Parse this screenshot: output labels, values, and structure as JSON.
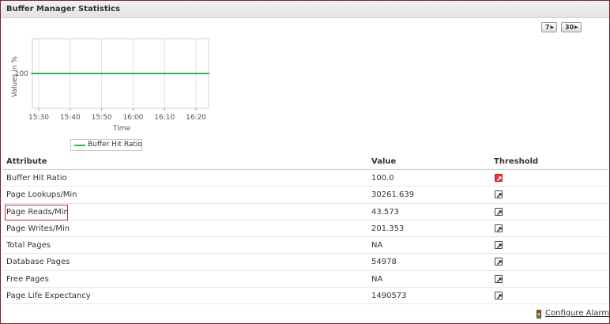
{
  "panel": {
    "title": "Buffer Manager Statistics"
  },
  "period_buttons": [
    {
      "label": "7"
    },
    {
      "label": "30"
    }
  ],
  "chart_data": {
    "type": "line",
    "ylabel": "Values in %",
    "xlabel": "Time",
    "x_ticks": [
      "15:30",
      "15:40",
      "15:50",
      "16:00",
      "16:10",
      "16:20"
    ],
    "y_ticks": [
      100
    ],
    "xlim": [
      "15:28",
      "16:24"
    ],
    "ylim": [
      0,
      200
    ],
    "grid": true,
    "legend_position": "bottom",
    "series": [
      {
        "name": "Buffer Hit Ratio",
        "color": "#3cb043",
        "x": [
          "15:28",
          "15:32",
          "15:36",
          "15:40",
          "15:44",
          "15:48",
          "15:52",
          "15:56",
          "16:00",
          "16:04",
          "16:08",
          "16:12",
          "16:16",
          "16:20",
          "16:24"
        ],
        "values": [
          100,
          100,
          100,
          100,
          100,
          100,
          100,
          100,
          100,
          100,
          100,
          100,
          100,
          100,
          100
        ]
      }
    ]
  },
  "table": {
    "headers": {
      "attribute": "Attribute",
      "value": "Value",
      "threshold": "Threshold"
    },
    "rows": [
      {
        "attribute": "Buffer Hit Ratio",
        "value": "100.0",
        "alarm": true
      },
      {
        "attribute": "Page Lookups/Min",
        "value": "30261.639",
        "alarm": false
      },
      {
        "attribute": "Page Reads/Min",
        "value": "43.573",
        "alarm": false,
        "highlighted": true
      },
      {
        "attribute": "Page Writes/Min",
        "value": "201.353",
        "alarm": false
      },
      {
        "attribute": "Total Pages",
        "value": "NA",
        "alarm": false
      },
      {
        "attribute": "Database Pages",
        "value": "54978",
        "alarm": false
      },
      {
        "attribute": "Free Pages",
        "value": "NA",
        "alarm": false
      },
      {
        "attribute": "Page Life Expectancy",
        "value": "1490573",
        "alarm": false
      }
    ]
  },
  "footer": {
    "configure_alarms": "Configure Alarms"
  },
  "icons": {
    "period_arrow": "play-arrow-icon",
    "threshold": "edit-threshold-icon",
    "alarms": "traffic-light-icon"
  }
}
